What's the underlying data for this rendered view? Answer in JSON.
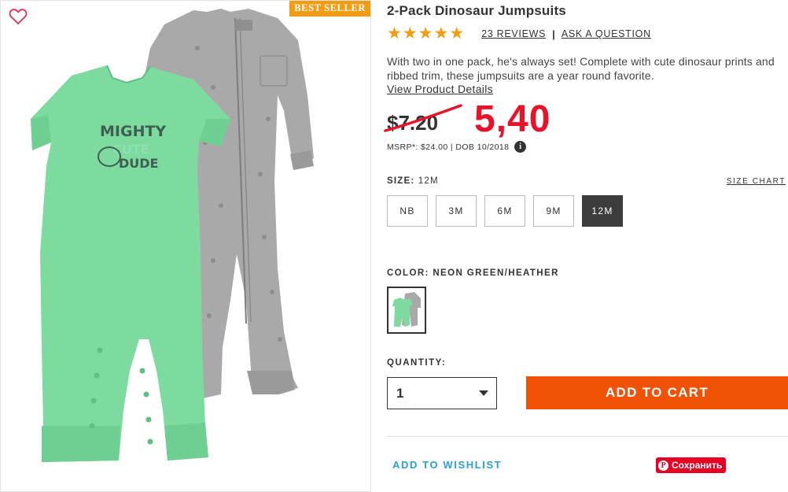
{
  "badge": "BEST SELLER",
  "product": {
    "title": "2-Pack Dinosaur Jumpsuits",
    "rating": 5,
    "reviews_label": "23 REVIEWS",
    "separator": "|",
    "ask_label": "ASK A QUESTION",
    "description": "With two in one pack, he's always set! Complete with cute dinosaur prints and ribbed trim, these jumpsuits are a year round favorite.",
    "details_link": "View Product Details",
    "graphic_text": "MIGHTY CUTE DUDE"
  },
  "price": {
    "old": "$7.20",
    "new": "5,40",
    "msrp_line": "MSRP*: $24.00 | DOB 10/2018",
    "info_icon": "i"
  },
  "size": {
    "label": "SIZE:",
    "selected": "12M",
    "chart_link": "SIZE CHART",
    "options": [
      "NB",
      "3M",
      "6M",
      "9M",
      "12M"
    ]
  },
  "color": {
    "label": "COLOR: NEON GREEN/HEATHER"
  },
  "quantity": {
    "label": "QUANTITY:",
    "value": "1"
  },
  "actions": {
    "add_to_cart": "ADD TO CART",
    "add_to_wishlist": "ADD TO WISHLIST",
    "pin_label": "Сохранить",
    "pin_icon": "P"
  },
  "colors": {
    "accent_orange": "#ef5106",
    "badge_orange": "#f39c12",
    "sale_red": "#e8132b",
    "link_blue": "#2a9fd6",
    "mint_green": "#7ddba0",
    "heather_gray": "#a9a9a9"
  },
  "icons": {
    "wishlist": "heart-outline-icon",
    "star": "star-icon",
    "info": "info-icon",
    "dropdown": "chevron-down-icon",
    "pinterest": "pinterest-icon"
  }
}
